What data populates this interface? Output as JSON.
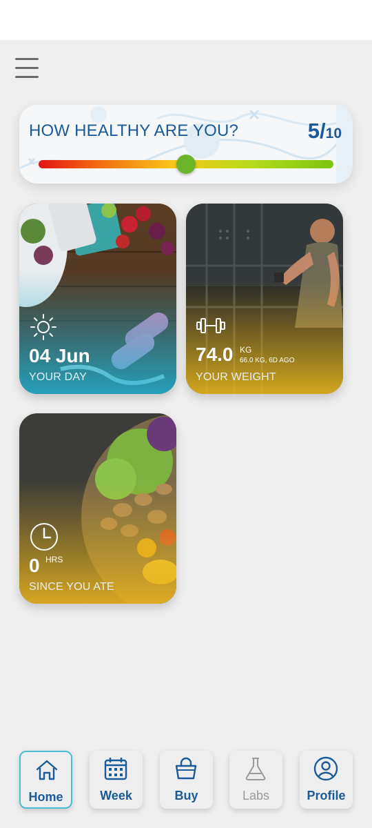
{
  "health": {
    "title": "HOW HEALTHY ARE YOU?",
    "score": "5/",
    "max": "10",
    "level": 0.5
  },
  "tiles": {
    "day": {
      "value": "04 Jun",
      "label": "YOUR DAY",
      "icon": "sun-icon"
    },
    "weight": {
      "value": "74.0",
      "unit": "KG",
      "sub": "66.0 KG, 6D AGO",
      "label": "YOUR WEIGHT",
      "icon": "dumbbell-icon"
    },
    "meal": {
      "value": "0",
      "unit": "HRS",
      "label": "SINCE YOU ATE",
      "icon": "clock-icon"
    }
  },
  "nav": {
    "home": "Home",
    "week": "Week",
    "buy": "Buy",
    "labs": "Labs",
    "profile": "Profile"
  },
  "colors": {
    "primary": "#1a5a98",
    "active_border": "#4bbcd4",
    "background": "#efefef"
  }
}
